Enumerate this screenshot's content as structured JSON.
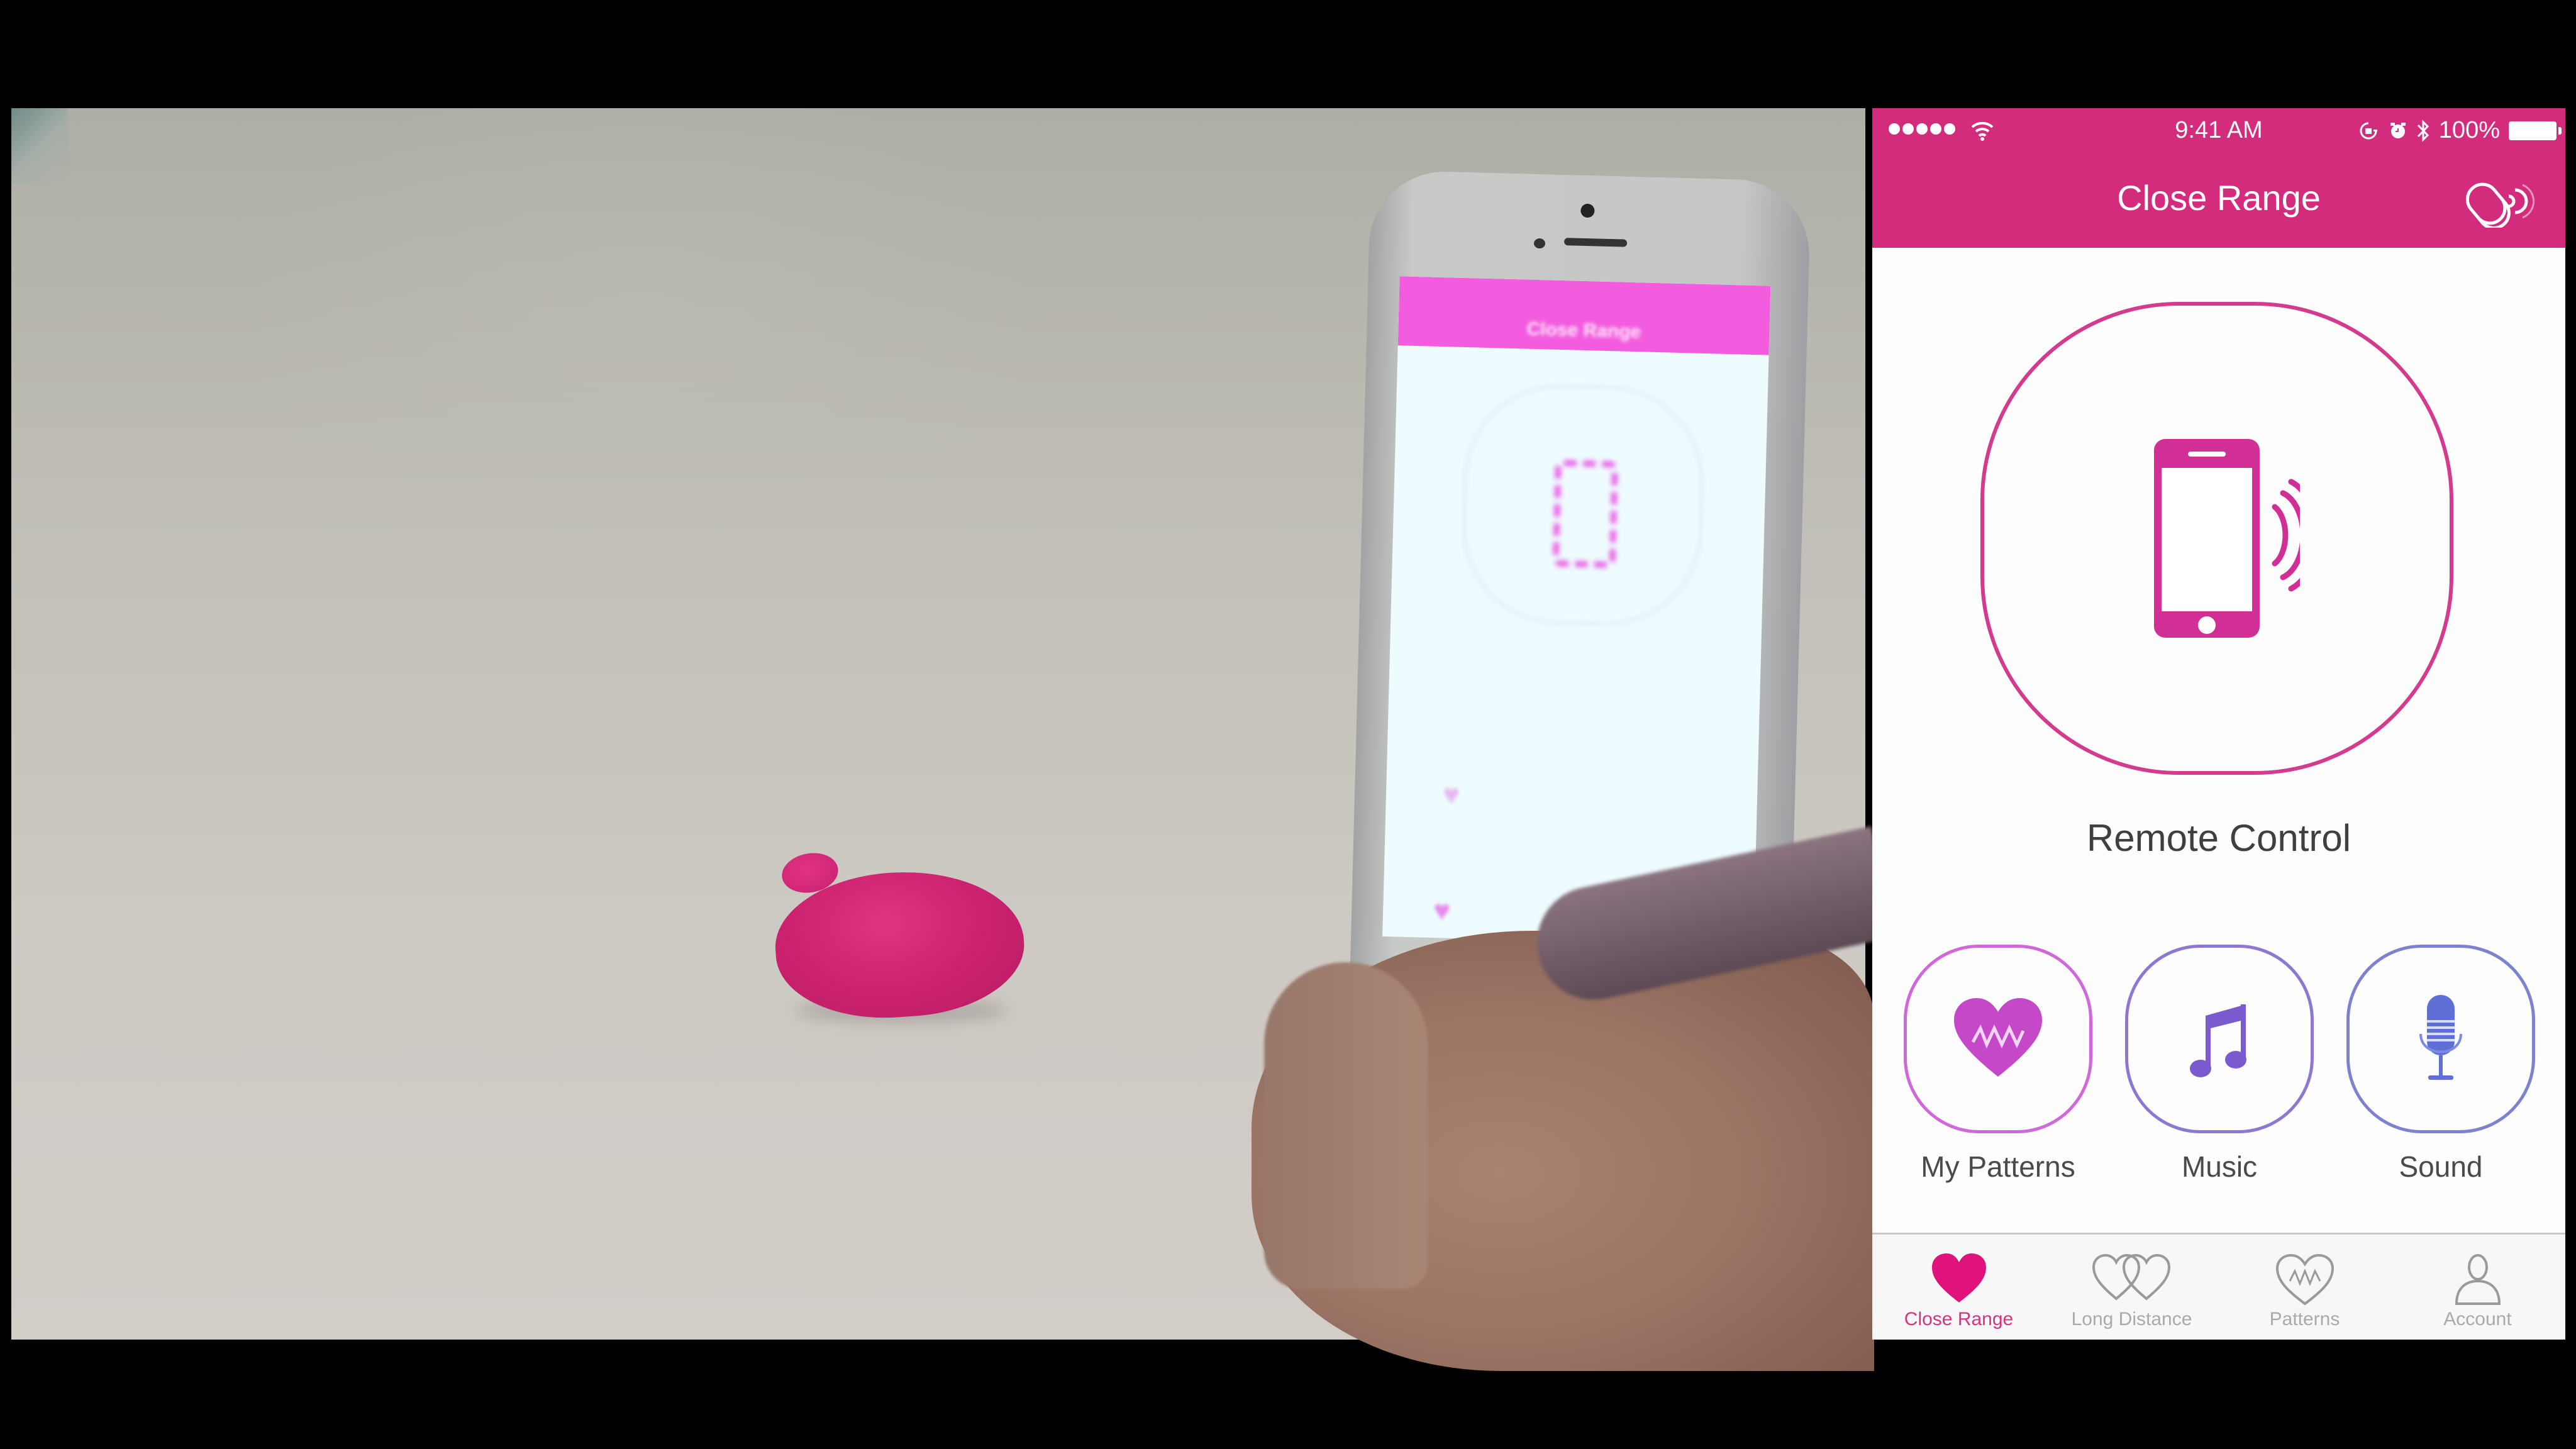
{
  "video": {
    "description": "Product demo video frame: pink toy on table, hand tapping phone running the app",
    "toy_color": "#cc2270"
  },
  "app": {
    "colors": {
      "brand": "#d42c7c",
      "active_tab": "#d6357e",
      "my_patterns": "#c548c9",
      "music": "#7b5ad0",
      "sound": "#5f6fd6",
      "inactive_tab": "#aaaaaa"
    },
    "status_bar": {
      "signal_bars": 5,
      "wifi_icon": "wifi-icon",
      "time": "9:41 AM",
      "icons": [
        "rotation-lock-icon",
        "alarm-icon",
        "bluetooth-icon"
      ],
      "battery_percent": "100%",
      "battery_level": 1.0
    },
    "header": {
      "title": "Close Range",
      "right_icon": "device-connection-icon"
    },
    "main": {
      "remote_control_icon": "phone-waves-icon",
      "remote_control_label": "Remote Control",
      "features": [
        {
          "label": "My Patterns",
          "icon": "heart-pulse-icon"
        },
        {
          "label": "Music",
          "icon": "music-note-icon"
        },
        {
          "label": "Sound",
          "icon": "microphone-icon"
        }
      ]
    },
    "tabbar": {
      "active_index": 0,
      "tabs": [
        {
          "label": "Close Range",
          "icon": "heart-filled-icon"
        },
        {
          "label": "Long Distance",
          "icon": "double-heart-icon"
        },
        {
          "label": "Patterns",
          "icon": "heart-pulse-outline-icon"
        },
        {
          "label": "Account",
          "icon": "person-icon"
        }
      ]
    }
  }
}
